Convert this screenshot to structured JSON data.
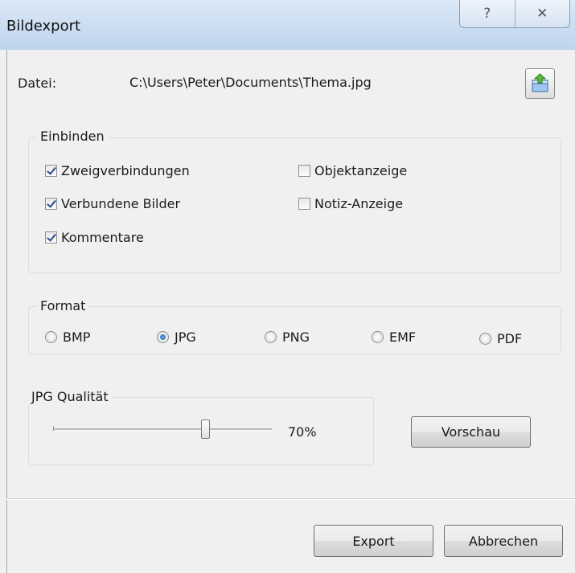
{
  "window": {
    "title": "Bildexport",
    "help_glyph": "?",
    "close_glyph": "✕"
  },
  "file": {
    "label": "Datei:",
    "path": "C:\\Users\\Peter\\Documents\\Thema.jpg",
    "open_icon": "open-folder-icon"
  },
  "include": {
    "legend": "Einbinden",
    "options": [
      {
        "label": "Zweigverbindungen",
        "checked": true
      },
      {
        "label": "Verbundene Bilder",
        "checked": true
      },
      {
        "label": "Kommentare",
        "checked": true
      },
      {
        "label": "Objektanzeige",
        "checked": false
      },
      {
        "label": "Notiz-Anzeige",
        "checked": false
      }
    ]
  },
  "format": {
    "legend": "Format",
    "options": [
      "BMP",
      "JPG",
      "PNG",
      "EMF",
      "PDF"
    ],
    "selected": "JPG"
  },
  "quality": {
    "legend": "JPG Qualität",
    "value": 70,
    "value_text": "70%",
    "preview_label": "Vorschau"
  },
  "footer": {
    "export_label": "Export",
    "cancel_label": "Abbrechen"
  },
  "colors": {
    "title_bar": "#c9dcf1",
    "radio_selected": "#1d5fb6"
  }
}
